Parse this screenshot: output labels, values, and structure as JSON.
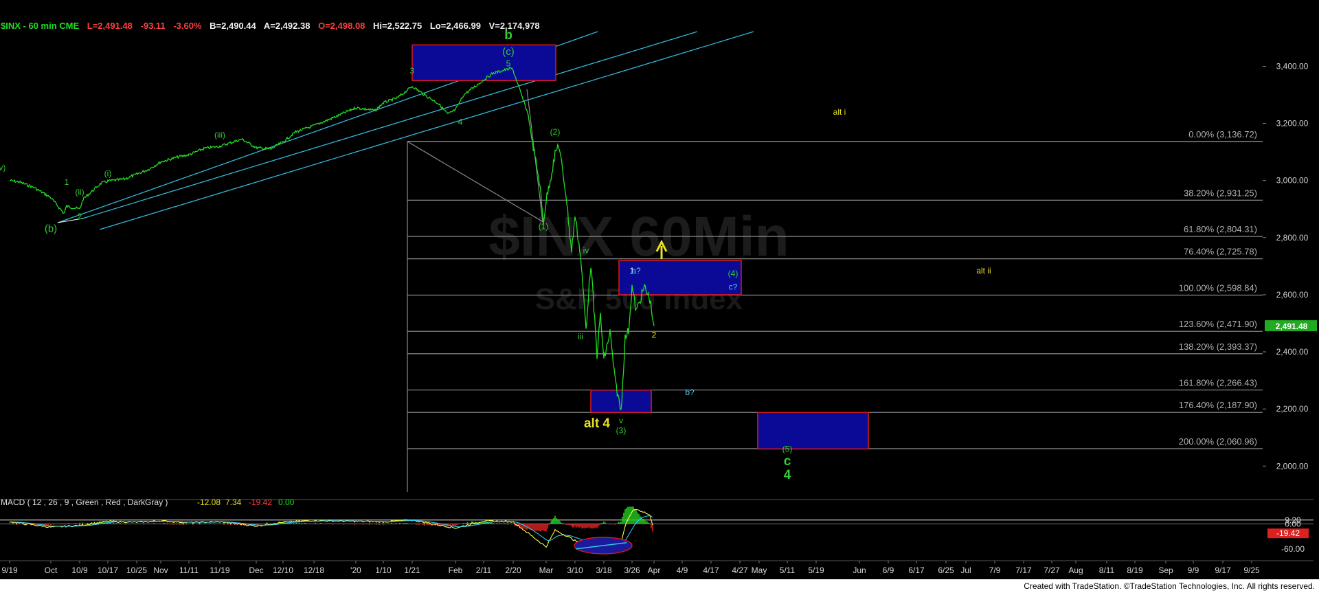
{
  "header": {
    "symbol": "$INX - 60 min  CME",
    "L": "L=2,491.48",
    "chg": "-93.11",
    "pct": "-3.60%",
    "B": "B=2,490.44",
    "A": "A=2,492.38",
    "O": "O=2,498.08",
    "Hi": "Hi=2,522.75",
    "Lo": "Lo=2,466.99",
    "V": "V=2,174,978"
  },
  "watermark": {
    "line1": "$INX 60Min",
    "line2": "S&P 500 Index"
  },
  "footer": {
    "credit": "Created with TradeStation. ©TradeStation Technologies, Inc. All rights reserved."
  },
  "colors": {
    "background": "#000000",
    "price": "#22dd22",
    "channel": "#33b8d8",
    "fib_line": "#9a9a9a",
    "box_fill": "#0a0a96",
    "box_border": "#e01818",
    "wave_green": "#33cc33",
    "alt_yellow": "#e8e020",
    "cyan_label": "#55ccee",
    "last_price_bg": "#22aa22",
    "macd_neg_bg": "#dd2020"
  },
  "chart_data": {
    "type": "line",
    "title": "$INX - 60 min",
    "ylim": [
      1890,
      3560
    ],
    "y_ticks": [
      "2,000.00",
      "2,200.00",
      "2,400.00",
      "2,600.00",
      "2,800.00",
      "3,000.00",
      "3,200.00",
      "3,400.00"
    ],
    "y_tick_values": [
      2000,
      2200,
      2400,
      2600,
      2800,
      3000,
      3200,
      3400
    ],
    "x_tick_labels": [
      "9/19",
      "Oct",
      "10/9",
      "10/17",
      "10/25",
      "Nov",
      "11/11",
      "11/19",
      "Dec",
      "12/10",
      "12/18",
      "'20",
      "1/10",
      "1/21",
      "Feb",
      "2/11",
      "2/20",
      "Mar",
      "3/10",
      "3/18",
      "3/26",
      "Apr",
      "4/9",
      "4/17",
      "4/27",
      "May",
      "5/11",
      "5/19",
      "Jun",
      "6/9",
      "6/17",
      "6/25",
      "Jul",
      "7/9",
      "7/17",
      "7/27",
      "Aug",
      "8/11",
      "8/19",
      "Sep",
      "9/9",
      "9/17",
      "9/25"
    ],
    "last_price": "2,491.48",
    "last_price_value": 2491.48,
    "series": [
      {
        "name": "$INX",
        "points": [
          [
            "9/19",
            3000
          ],
          [
            "9/23",
            2995
          ],
          [
            "9/26",
            2975
          ],
          [
            "Oct",
            2940
          ],
          [
            "10/3",
            2885
          ],
          [
            "10/4",
            2910
          ],
          [
            "10/9",
            2900
          ],
          [
            "10/10",
            2935
          ],
          [
            "10/15",
            2990
          ],
          [
            "10/17",
            2998
          ],
          [
            "10/22",
            3005
          ],
          [
            "10/25",
            3022
          ],
          [
            "10/29",
            3040
          ],
          [
            "Nov",
            3065
          ],
          [
            "11/7",
            3082
          ],
          [
            "11/11",
            3090
          ],
          [
            "11/15",
            3112
          ],
          [
            "11/19",
            3120
          ],
          [
            "11/26",
            3145
          ],
          [
            "Dec",
            3115
          ],
          [
            "12/5",
            3110
          ],
          [
            "12/10",
            3135
          ],
          [
            "12/13",
            3170
          ],
          [
            "12/18",
            3192
          ],
          [
            "12/24",
            3222
          ],
          [
            "'20",
            3255
          ],
          [
            "1/7",
            3245
          ],
          [
            "1/10",
            3272
          ],
          [
            "1/15",
            3290
          ],
          [
            "1/21",
            3330
          ],
          [
            "1/24",
            3300
          ],
          [
            "1/28",
            3270
          ],
          [
            "1/31",
            3232
          ],
          [
            "Feb",
            3248
          ],
          [
            "2/5",
            3300
          ],
          [
            "2/11",
            3352
          ],
          [
            "2/14",
            3375
          ],
          [
            "2/19",
            3393
          ],
          [
            "2/20",
            3385
          ],
          [
            "2/24",
            3230
          ],
          [
            "2/25",
            3130
          ],
          [
            "2/27",
            3000
          ],
          [
            "2/28",
            2856
          ],
          [
            "Mar",
            2930
          ],
          [
            "3/3",
            3090
          ],
          [
            "3/4",
            3130
          ],
          [
            "3/6",
            2950
          ],
          [
            "3/9",
            2750
          ],
          [
            "3/10",
            2880
          ],
          [
            "3/11",
            2740
          ],
          [
            "3/12",
            2480
          ],
          [
            "3/13",
            2710
          ],
          [
            "3/16",
            2390
          ],
          [
            "3/17",
            2530
          ],
          [
            "3/18",
            2370
          ],
          [
            "3/19",
            2470
          ],
          [
            "3/20",
            2304
          ],
          [
            "3/23",
            2191
          ],
          [
            "3/24",
            2448
          ],
          [
            "3/25",
            2476
          ],
          [
            "3/26",
            2630
          ],
          [
            "3/27",
            2541
          ],
          [
            "3/30",
            2627
          ],
          [
            "3/31",
            2584
          ],
          [
            "Apr",
            2491
          ]
        ]
      }
    ],
    "fib_levels": [
      {
        "label": "0.00% (3,136.72)",
        "value": 3136.72
      },
      {
        "label": "38.20% (2,931.25)",
        "value": 2931.25
      },
      {
        "label": "61.80% (2,804.31)",
        "value": 2804.31
      },
      {
        "label": "76.40% (2,725.78)",
        "value": 2725.78
      },
      {
        "label": "100.00% (2,598.84)",
        "value": 2598.84
      },
      {
        "label": "123.60% (2,471.90)",
        "value": 2471.9
      },
      {
        "label": "138.20% (2,393.37)",
        "value": 2393.37
      },
      {
        "label": "161.80% (2,266.43)",
        "value": 2266.43
      },
      {
        "label": "176.40% (2,187.90)",
        "value": 2187.9
      },
      {
        "label": "200.00% (2,060.96)",
        "value": 2060.96
      }
    ],
    "target_boxes": [
      {
        "name": "top box",
        "y_low": 3350,
        "y_high": 3475,
        "x_from": "1/21",
        "x_to": "2/24"
      },
      {
        "name": "resistance box",
        "y_low": 2600,
        "y_high": 2720,
        "x_from": "3/23",
        "x_to": "4/17"
      },
      {
        "name": "support box",
        "y_low": 2188,
        "y_high": 2266,
        "x_from": "3/16",
        "x_to": "3/26"
      },
      {
        "name": "wave 4 target box",
        "y_low": 2060,
        "y_high": 2188,
        "x_from": "4/27",
        "x_to": "5/19"
      }
    ],
    "wave_labels": [
      {
        "text": "b",
        "x": "2/18",
        "y": 3495,
        "color": "green",
        "size": "large"
      },
      {
        "text": "(c)",
        "x": "2/18",
        "y": 3440,
        "color": "green",
        "size": "medium"
      },
      {
        "text": "5",
        "x": "2/18",
        "y": 3400,
        "color": "green",
        "size": "small"
      },
      {
        "text": "3",
        "x": "1/21",
        "y": 3375,
        "color": "green",
        "size": "small"
      },
      {
        "text": "4",
        "x": "2/4",
        "y": 3195,
        "color": "green",
        "size": "small"
      },
      {
        "text": "(iii)",
        "x": "11/19",
        "y": 3150,
        "color": "green",
        "size": "small"
      },
      {
        "text": "(iv)",
        "x": "12/1",
        "y": 3035,
        "color": "green",
        "size": "small"
      },
      {
        "text": "(ii)",
        "x": "10/9",
        "y": 2950,
        "color": "green",
        "size": "small"
      },
      {
        "text": "(i)",
        "x": "10/17",
        "y": 3015,
        "color": "green",
        "size": "small"
      },
      {
        "text": "1",
        "x": "10/4",
        "y": 2985,
        "color": "green",
        "size": "small"
      },
      {
        "text": "2",
        "x": "10/9",
        "y": 2865,
        "color": "green",
        "size": "small"
      },
      {
        "text": "(b)",
        "x": "Oct",
        "y": 2820,
        "color": "green",
        "size": "medium"
      },
      {
        "text": "(2)",
        "x": "3/3",
        "y": 3160,
        "color": "green",
        "size": "small"
      },
      {
        "text": "(1)",
        "x": "2/28",
        "y": 2830,
        "color": "green",
        "size": "small"
      },
      {
        "text": "iv",
        "x": "3/12",
        "y": 2745,
        "color": "green",
        "size": "small"
      },
      {
        "text": "iii",
        "x": "3/11",
        "y": 2445,
        "color": "green",
        "size": "small"
      },
      {
        "text": "v",
        "x": "3/23",
        "y": 2150,
        "color": "green",
        "size": "small"
      },
      {
        "text": "(3)",
        "x": "3/23",
        "y": 2115,
        "color": "green",
        "size": "small"
      },
      {
        "text": "1",
        "x": "3/26",
        "y": 2675,
        "color": "white",
        "size": "small"
      },
      {
        "text": "a?",
        "x": "3/27",
        "y": 2675,
        "color": "cyan",
        "size": "small"
      },
      {
        "text": "(4)",
        "x": "4/14",
        "y": 2665,
        "color": "green",
        "size": "small"
      },
      {
        "text": "c?",
        "x": "4/14",
        "y": 2618,
        "color": "cyan",
        "size": "small"
      },
      {
        "text": "2",
        "x": "Apr",
        "y": 2450,
        "color": "yellow",
        "size": "small"
      },
      {
        "text": "b?",
        "x": "4/6",
        "y": 2248,
        "color": "cyan",
        "size": "small"
      },
      {
        "text": "alt 4",
        "x": "3/16",
        "y": 2135,
        "color": "yellow",
        "size": "large"
      },
      {
        "text": "alt i",
        "x": "5/23",
        "y": 3230,
        "color": "yellow",
        "size": "small"
      },
      {
        "text": "alt ii",
        "x": "7/10",
        "y": 2675,
        "color": "yellow",
        "size": "small"
      },
      {
        "text": "(5)",
        "x": "5/11",
        "y": 2050,
        "color": "green",
        "size": "small"
      },
      {
        "text": "c",
        "x": "5/11",
        "y": 2003,
        "color": "green",
        "size": "large"
      },
      {
        "text": "4",
        "x": "5/11",
        "y": 1955,
        "color": "green",
        "size": "large"
      }
    ],
    "macd": {
      "header": "MACD ( 12 , 26 , 9 , Green , Red , DarkGray )",
      "macd_value": "-12.08",
      "signal_value": "7.34",
      "diff_value": "-19.42",
      "extra_value": "0.00",
      "ticks": [
        "9.20",
        "0.00",
        "-60.00"
      ],
      "tick_values": [
        9.2,
        0,
        -60
      ],
      "last_badge": "-19.42",
      "ylim": [
        -75,
        45
      ],
      "values_by_date": [
        [
          "9/19",
          5
        ],
        [
          "Oct",
          -8
        ],
        [
          "10/9",
          -4
        ],
        [
          "10/17",
          6
        ],
        [
          "10/25",
          4
        ],
        [
          "Nov",
          7
        ],
        [
          "11/11",
          3
        ],
        [
          "11/19",
          5
        ],
        [
          "Dec",
          -5
        ],
        [
          "12/10",
          4
        ],
        [
          "12/18",
          8
        ],
        [
          "'20",
          6
        ],
        [
          "1/10",
          5
        ],
        [
          "1/21",
          9
        ],
        [
          "Feb",
          -10
        ],
        [
          "2/11",
          7
        ],
        [
          "2/20",
          5
        ],
        [
          "2/25",
          -30
        ],
        [
          "Mar",
          -55
        ],
        [
          "3/3",
          -15
        ],
        [
          "3/6",
          -28
        ],
        [
          "3/10",
          -40
        ],
        [
          "3/12",
          -52
        ],
        [
          "3/16",
          -62
        ],
        [
          "3/18",
          -48
        ],
        [
          "3/20",
          -55
        ],
        [
          "3/23",
          -45
        ],
        [
          "3/24",
          -5
        ],
        [
          "3/26",
          30
        ],
        [
          "3/27",
          35
        ],
        [
          "3/30",
          28
        ],
        [
          "3/31",
          20
        ],
        [
          "Apr",
          -12
        ]
      ]
    }
  }
}
